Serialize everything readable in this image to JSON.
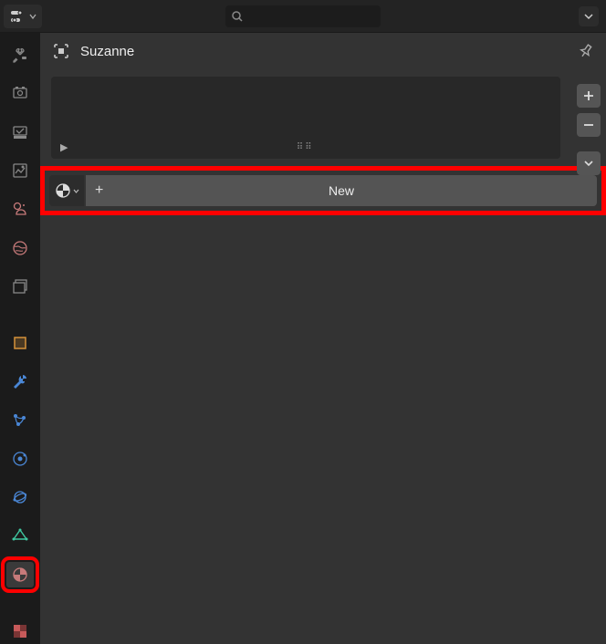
{
  "header": {
    "object_name": "Suzanne"
  },
  "material": {
    "new_button_label": "New"
  },
  "vtabs": [
    {
      "id": "tool",
      "color": "#888888"
    },
    {
      "id": "render",
      "color": "#888888"
    },
    {
      "id": "output",
      "color": "#888888"
    },
    {
      "id": "viewlayer",
      "color": "#888888"
    },
    {
      "id": "scene",
      "color": "#c77a7a"
    },
    {
      "id": "world",
      "color": "#c77a7a"
    },
    {
      "id": "collection",
      "color": "#888888"
    },
    {
      "id": "object",
      "color": "#d6923a"
    },
    {
      "id": "modifiers",
      "color": "#4a87d6"
    },
    {
      "id": "particles",
      "color": "#4a87d6"
    },
    {
      "id": "physics",
      "color": "#4a87d6"
    },
    {
      "id": "constraints",
      "color": "#4a87d6"
    },
    {
      "id": "data",
      "color": "#3fc7a0"
    },
    {
      "id": "material-tab",
      "color": "#c77a7a"
    },
    {
      "id": "texture",
      "color": "#c77a7a"
    }
  ]
}
